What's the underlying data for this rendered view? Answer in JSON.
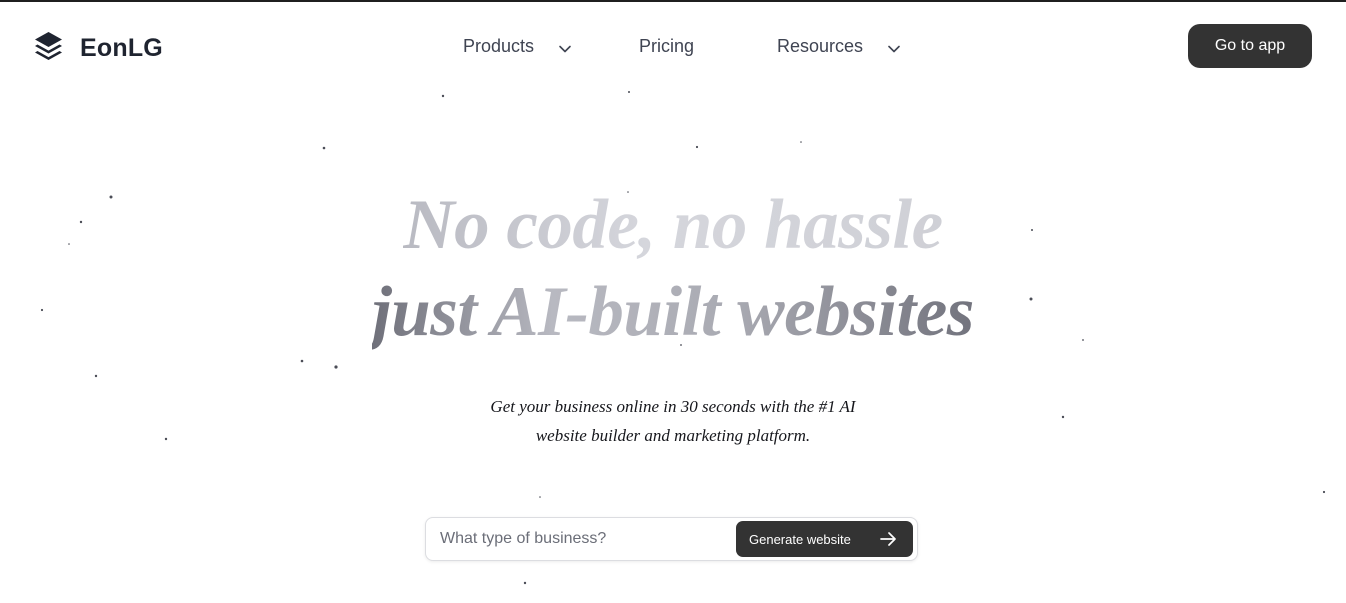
{
  "brand": {
    "name": "EonLG"
  },
  "nav": {
    "products": "Products",
    "pricing": "Pricing",
    "resources": "Resources"
  },
  "header": {
    "cta": "Go to app"
  },
  "hero": {
    "line1": "No code, no hassle",
    "line2": "just AI-built websites",
    "subtitle_line1": "Get your business online in 30 seconds with the #1 AI",
    "subtitle_line2": "website builder and marketing platform."
  },
  "search": {
    "placeholder": "What type of business?",
    "button": "Generate website"
  },
  "colors": {
    "dark": "#333333",
    "text": "#1f2430"
  },
  "icons": [
    "layers-icon",
    "chevron-down-icon",
    "arrow-right-icon"
  ]
}
